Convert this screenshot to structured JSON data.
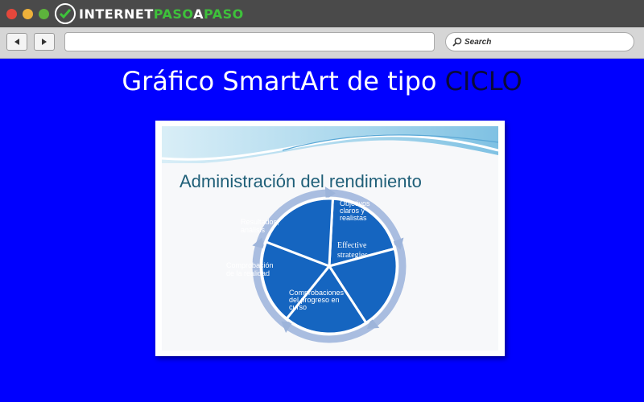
{
  "browser": {
    "logo_a": "INTERNET",
    "logo_b": "PASO",
    "logo_c": "A",
    "logo_d": "PASO",
    "search_placeholder": "Search",
    "back_icon": "back-arrow-icon",
    "forward_icon": "forward-arrow-icon"
  },
  "page": {
    "heading_main": "Gráfico SmartArt de tipo ",
    "heading_accent": "CICLO"
  },
  "slide": {
    "title": "Administración del rendimiento",
    "segments": [
      {
        "lines": [
          "Objetivos",
          "claros y",
          "realistas"
        ]
      },
      {
        "lines": [
          "Effective",
          "strategies"
        ]
      },
      {
        "lines": [
          "Comprobaciones",
          "del progreso en",
          "curso"
        ]
      },
      {
        "lines": [
          "Comprobación",
          "de la realidad"
        ]
      },
      {
        "lines": [
          "Resultados,",
          "análisis"
        ]
      }
    ]
  },
  "colors": {
    "background": "#0000ff",
    "segment_fill": "#1565c0",
    "arrow_ring": "#9db4da"
  }
}
